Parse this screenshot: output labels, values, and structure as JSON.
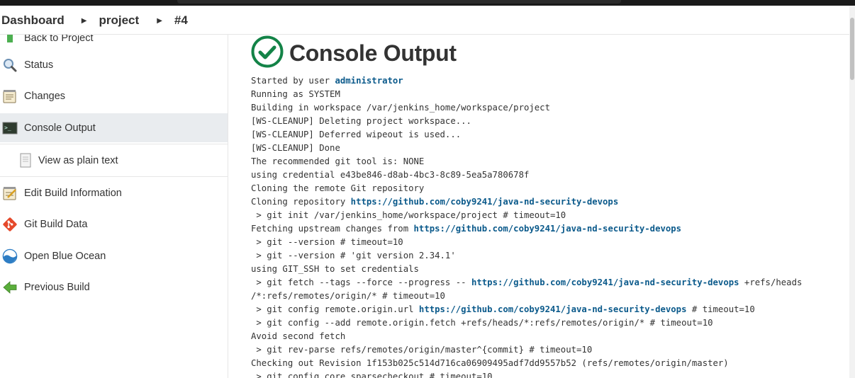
{
  "breadcrumb": {
    "items": [
      "Dashboard",
      "project",
      "#4"
    ]
  },
  "sidebar": {
    "items": [
      {
        "label": "Back to Project"
      },
      {
        "label": "Status"
      },
      {
        "label": "Changes"
      },
      {
        "label": "Console Output"
      },
      {
        "label": "View as plain text"
      },
      {
        "label": "Edit Build Information"
      },
      {
        "label": "Git Build Data"
      },
      {
        "label": "Open Blue Ocean"
      },
      {
        "label": "Previous Build"
      }
    ]
  },
  "main": {
    "title": "Console Output",
    "status": "success",
    "console": [
      {
        "text": "Started by user ",
        "link": "administrator",
        "after": ""
      },
      {
        "text": "Running as SYSTEM"
      },
      {
        "text": "Building in workspace /var/jenkins_home/workspace/project"
      },
      {
        "text": "[WS-CLEANUP] Deleting project workspace..."
      },
      {
        "text": "[WS-CLEANUP] Deferred wipeout is used..."
      },
      {
        "text": "[WS-CLEANUP] Done"
      },
      {
        "text": "The recommended git tool is: NONE"
      },
      {
        "text": "using credential e43be846-d8ab-4bc3-8c89-5ea5a780678f"
      },
      {
        "text": "Cloning the remote Git repository"
      },
      {
        "text": "Cloning repository ",
        "link": "https://github.com/coby9241/java-nd-security-devops",
        "after": ""
      },
      {
        "text": " > git init /var/jenkins_home/workspace/project # timeout=10"
      },
      {
        "text": "Fetching upstream changes from ",
        "link": "https://github.com/coby9241/java-nd-security-devops",
        "after": ""
      },
      {
        "text": " > git --version # timeout=10"
      },
      {
        "text": " > git --version # 'git version 2.34.1'"
      },
      {
        "text": "using GIT_SSH to set credentials"
      },
      {
        "text": " > git fetch --tags --force --progress -- ",
        "link": "https://github.com/coby9241/java-nd-security-devops",
        "after": " +refs/heads"
      },
      {
        "text": "/*:refs/remotes/origin/* # timeout=10"
      },
      {
        "text": " > git config remote.origin.url ",
        "link": "https://github.com/coby9241/java-nd-security-devops",
        "after": " # timeout=10"
      },
      {
        "text": " > git config --add remote.origin.fetch +refs/heads/*:refs/remotes/origin/* # timeout=10"
      },
      {
        "text": "Avoid second fetch"
      },
      {
        "text": " > git rev-parse refs/remotes/origin/master^{commit} # timeout=10"
      },
      {
        "text": "Checking out Revision 1f153b025c514d716ca06909495adf7dd9557b52 (refs/remotes/origin/master)"
      },
      {
        "text": " > git config core.sparsecheckout # timeout=10"
      }
    ]
  },
  "colors": {
    "success": "#138347",
    "link": "#0b5a8b",
    "active_bg": "#e9ecef"
  },
  "icons": [
    "back-arrow-icon",
    "search-icon",
    "notepad-icon",
    "terminal-icon",
    "document-icon",
    "notepad-edit-icon",
    "git-icon",
    "blue-ocean-icon",
    "green-arrow-left-icon",
    "success-check-icon",
    "chevron-right-icon"
  ]
}
